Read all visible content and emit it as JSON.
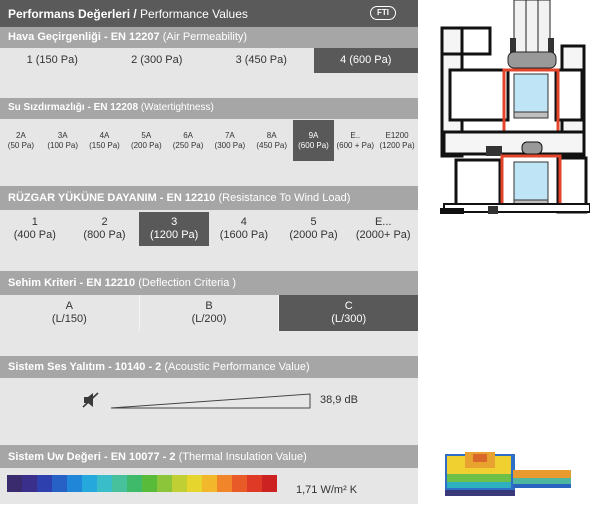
{
  "header": {
    "title_bold": "Performans Değerleri /",
    "title_rest": " Performance Values",
    "logo_text": "FTI"
  },
  "air": {
    "title": "Hava Geçirgenliği - EN 12207",
    "subtitle": " (Air Permeability)",
    "options": [
      {
        "label": "1",
        "value": "(150 Pa)",
        "selected": false
      },
      {
        "label": "2",
        "value": "(300 Pa)",
        "selected": false
      },
      {
        "label": "3",
        "value": "(450 Pa)",
        "selected": false
      },
      {
        "label": "4",
        "value": "(600 Pa)",
        "selected": true
      }
    ]
  },
  "water": {
    "title": "Su Sızdırmazlığı - EN 12208",
    "subtitle": " (Watertightness)",
    "options": [
      {
        "label": "2A",
        "value": "(50 Pa)",
        "selected": false
      },
      {
        "label": "3A",
        "value": "(100 Pa)",
        "selected": false
      },
      {
        "label": "4A",
        "value": "(150 Pa)",
        "selected": false
      },
      {
        "label": "5A",
        "value": "(200 Pa)",
        "selected": false
      },
      {
        "label": "6A",
        "value": "(250 Pa)",
        "selected": false
      },
      {
        "label": "7A",
        "value": "(300 Pa)",
        "selected": false
      },
      {
        "label": "8A",
        "value": "(450 Pa)",
        "selected": false
      },
      {
        "label": "9A",
        "value": "(600 Pa)",
        "selected": true
      },
      {
        "label": "E..",
        "value": "(600 + Pa)",
        "selected": false
      },
      {
        "label": "E1200",
        "value": "(1200 Pa)",
        "selected": false
      }
    ]
  },
  "wind": {
    "title": "RÜZGAR YÜKÜNE DAYANIM - EN 12210",
    "subtitle": " (Resistance To Wind Load)",
    "options": [
      {
        "label": "1",
        "value": "(400 Pa)",
        "selected": false
      },
      {
        "label": "2",
        "value": "(800 Pa)",
        "selected": false
      },
      {
        "label": "3",
        "value": "(1200 Pa)",
        "selected": true
      },
      {
        "label": "4",
        "value": "(1600 Pa)",
        "selected": false
      },
      {
        "label": "5",
        "value": "(2000 Pa)",
        "selected": false
      },
      {
        "label": "E...",
        "value": "(2000+ Pa)",
        "selected": false
      }
    ]
  },
  "deflection": {
    "title": "Sehim Kriteri - EN 12210",
    "subtitle": " (Deflection Criteria )",
    "options": [
      {
        "label": "A",
        "value": "(L/150)",
        "selected": false
      },
      {
        "label": "B",
        "value": "(L/200)",
        "selected": false
      },
      {
        "label": "C",
        "value": "(L/300)",
        "selected": true
      }
    ]
  },
  "acoustic": {
    "title": "Sistem Ses Yalıtım - 10140 - 2",
    "subtitle": " (Acoustic Performance Value)",
    "value": "38,9 dB",
    "icon": "muted-speaker-icon"
  },
  "thermal": {
    "title": "Sistem Uw Değeri - EN 10077 - 2",
    "subtitle": " (Thermal Insulation Value)",
    "value": "1,71 W/m² K",
    "scale_colors": [
      "#3a2a6e",
      "#3b2f8c",
      "#2e3fae",
      "#2861c6",
      "#1f86d8",
      "#25a9dd",
      "#39bdc8",
      "#46c19b",
      "#3fb96a",
      "#59bb3a",
      "#8cc53a",
      "#c0cf33",
      "#e6d52d",
      "#f2b72a",
      "#f0852a",
      "#e85a28",
      "#df3a26",
      "#cc2222"
    ]
  }
}
